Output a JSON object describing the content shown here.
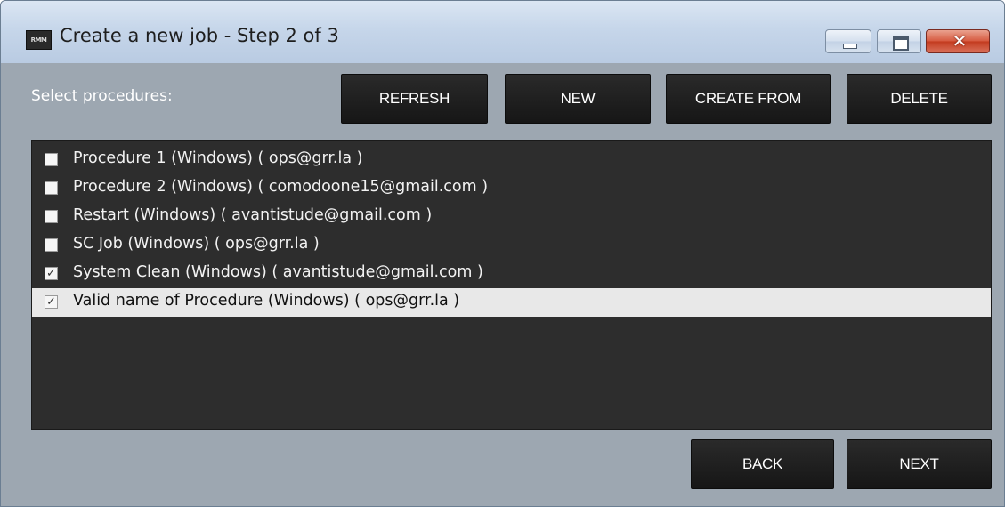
{
  "window": {
    "title": "Create a new job - Step 2 of 3",
    "app_icon_text": "RMM",
    "close_glyph": "✕"
  },
  "toolbar": {
    "label": "Select procedures:",
    "refresh_label": "REFRESH",
    "new_label": "NEW",
    "create_from_label": "CREATE FROM",
    "delete_label": "DELETE"
  },
  "procedures": [
    {
      "label": "Procedure 1 (Windows) ( ops@grr.la )",
      "checked": false,
      "selected": false
    },
    {
      "label": "Procedure 2 (Windows) ( comodoone15@gmail.com )",
      "checked": false,
      "selected": false
    },
    {
      "label": "Restart (Windows) ( avantistude@gmail.com )",
      "checked": false,
      "selected": false
    },
    {
      "label": "SC Job (Windows) ( ops@grr.la )",
      "checked": false,
      "selected": false
    },
    {
      "label": "System Clean (Windows) ( avantistude@gmail.com )",
      "checked": true,
      "selected": false
    },
    {
      "label": "Valid name of Procedure (Windows) ( ops@grr.la )",
      "checked": true,
      "selected": true
    }
  ],
  "footer": {
    "back_label": "BACK",
    "next_label": "NEXT"
  },
  "colors": {
    "body_bg": "#9da7b1",
    "list_bg": "#2d2d2d",
    "button_bg": "#1e1e1e",
    "selected_row_bg": "#e8e8e8",
    "close_button": "#c8432a"
  }
}
